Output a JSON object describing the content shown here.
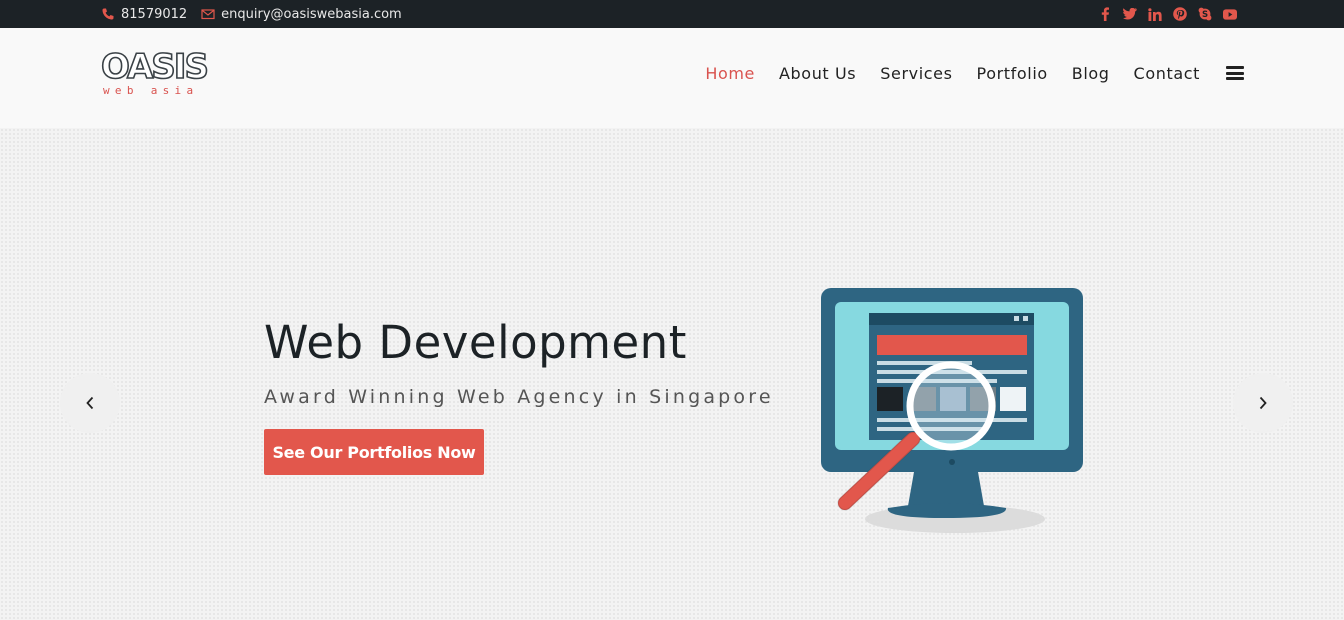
{
  "topbar": {
    "phone": "81579012",
    "email": "enquiry@oasiswebasia.com",
    "social": [
      "facebook-icon",
      "twitter-icon",
      "linkedin-icon",
      "pinterest-icon",
      "skype-icon",
      "youtube-icon"
    ]
  },
  "logo": {
    "word": "OASIS",
    "sub": "web asia"
  },
  "nav": {
    "items": [
      "Home",
      "About Us",
      "Services",
      "Portfolio",
      "Blog",
      "Contact"
    ],
    "active": "Home"
  },
  "hero": {
    "title": "Web Development",
    "tagline": "Award Winning Web Agency in Singapore",
    "cta": "See Our Portfolios Now"
  },
  "colors": {
    "accent": "#e2574c",
    "topbar": "#1c2226",
    "text": "#1c2226"
  }
}
